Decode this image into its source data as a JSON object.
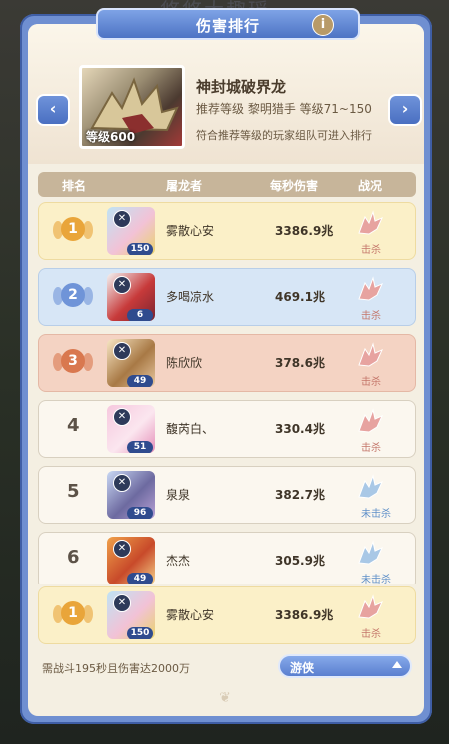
{
  "background_text": "悠悠大趣瑶",
  "dialog": {
    "title": "伤害排行",
    "info_label": "i",
    "prev_label": "‹",
    "next_label": "›"
  },
  "boss": {
    "name": "神封城破界龙",
    "level_badge": "等级600",
    "recommend": "推荐等级 黎明猎手 等级71~150",
    "note": "符合推荐等级的玩家组队可进入排行"
  },
  "table": {
    "headers": [
      "排名",
      "屠龙者",
      "每秒伤害",
      "战况"
    ]
  },
  "rows": [
    {
      "rank": "1",
      "name": "雾散心安",
      "level": "150",
      "dps": "3386.9兆",
      "status": "击杀",
      "status_color": "#c4766a",
      "dragon_color": "#e7a3a0",
      "avatar_colors": [
        "#bfe3f4",
        "#f2c2d6",
        "#e9d36b"
      ]
    },
    {
      "rank": "2",
      "name": "多喝凉水",
      "level": "6",
      "dps": "469.1兆",
      "status": "击杀",
      "status_color": "#c4766a",
      "dragon_color": "#e7a3a0",
      "avatar_colors": [
        "#f3f3f3",
        "#c73a3a",
        "#7a2430"
      ]
    },
    {
      "rank": "3",
      "name": "陈欣欣",
      "level": "49",
      "dps": "378.6兆",
      "status": "击杀",
      "status_color": "#c4766a",
      "dragon_color": "#e7a3a0",
      "avatar_colors": [
        "#f7e6c4",
        "#a87945",
        "#e8c8a0"
      ]
    },
    {
      "rank": "4",
      "name": "馥芮白、",
      "level": "51",
      "dps": "330.4兆",
      "status": "击杀",
      "status_color": "#c4766a",
      "dragon_color": "#e7a3a0",
      "avatar_colors": [
        "#f6c8de",
        "#fbe6ef",
        "#e58fb8"
      ]
    },
    {
      "rank": "5",
      "name": "泉泉",
      "level": "96",
      "dps": "382.7兆",
      "status": "未击杀",
      "status_color": "#5e8fc8",
      "dragon_color": "#a9c8e6",
      "avatar_colors": [
        "#c9d8f4",
        "#6d6aa0",
        "#b9a2d6"
      ]
    },
    {
      "rank": "6",
      "name": "杰杰",
      "level": "49",
      "dps": "305.9兆",
      "status": "未击杀",
      "status_color": "#5e8fc8",
      "dragon_color": "#a9c8e6",
      "avatar_colors": [
        "#f0a14a",
        "#c84a2a",
        "#f6d28a"
      ]
    }
  ],
  "my_row": {
    "rank": "1",
    "name": "雾散心安",
    "level": "150",
    "dps": "3386.9兆",
    "status": "击杀",
    "status_color": "#c4766a",
    "dragon_color": "#e7a3a0",
    "avatar_colors": [
      "#bfe3f4",
      "#f2c2d6",
      "#e9d36b"
    ]
  },
  "footer": {
    "requirement": "需战斗195秒且伤害达2000万",
    "class_select": "游侠"
  },
  "colors": {
    "gold_medal": "#e9a53a",
    "silver_medal": "#6f94d8",
    "bronze_medal": "#d9784f"
  }
}
